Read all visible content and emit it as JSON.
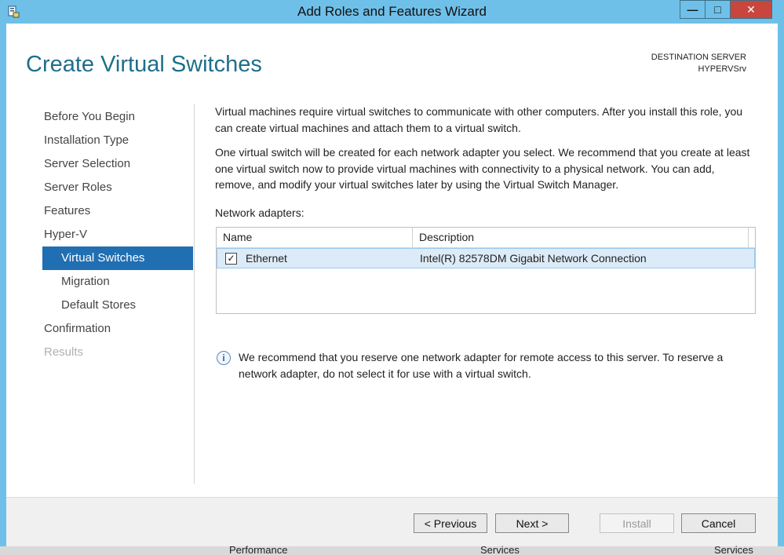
{
  "window": {
    "title": "Add Roles and Features Wizard",
    "controls": {
      "minimize": "—",
      "maximize": "□",
      "close": "✕"
    }
  },
  "header": {
    "title": "Create Virtual Switches",
    "destination_label": "DESTINATION SERVER",
    "destination_server": "HYPERVSrv"
  },
  "nav": {
    "items": [
      {
        "label": "Before You Begin"
      },
      {
        "label": "Installation Type"
      },
      {
        "label": "Server Selection"
      },
      {
        "label": "Server Roles"
      },
      {
        "label": "Features"
      },
      {
        "label": "Hyper-V"
      },
      {
        "label": "Virtual Switches"
      },
      {
        "label": "Migration"
      },
      {
        "label": "Default Stores"
      },
      {
        "label": "Confirmation"
      },
      {
        "label": "Results"
      }
    ]
  },
  "content": {
    "para1": "Virtual machines require virtual switches to communicate with other computers. After you install this role, you can create virtual machines and attach them to a virtual switch.",
    "para2": "One virtual switch will be created for each network adapter you select. We recommend that you create at least one virtual switch now to provide virtual machines with connectivity to a physical network. You can add, remove, and modify your virtual switches later by using the Virtual Switch Manager.",
    "adapters_label": "Network adapters:",
    "table": {
      "columns": [
        "Name",
        "Description"
      ],
      "rows": [
        {
          "checked": true,
          "name": "Ethernet",
          "description": "Intel(R) 82578DM Gigabit Network Connection"
        }
      ]
    },
    "info": "We recommend that you reserve one network adapter for remote access to this server. To reserve a network adapter, do not select it for use with a virtual switch."
  },
  "footer": {
    "previous": "< Previous",
    "next": "Next >",
    "install": "Install",
    "cancel": "Cancel"
  },
  "taskbar": {
    "items": [
      "Performance",
      "Services",
      "Services"
    ]
  },
  "colors": {
    "accent_blue": "#1f6fb2",
    "titlebar": "#6fc0e8",
    "close_red": "#c9463d",
    "header_teal": "#1f6e8c"
  }
}
